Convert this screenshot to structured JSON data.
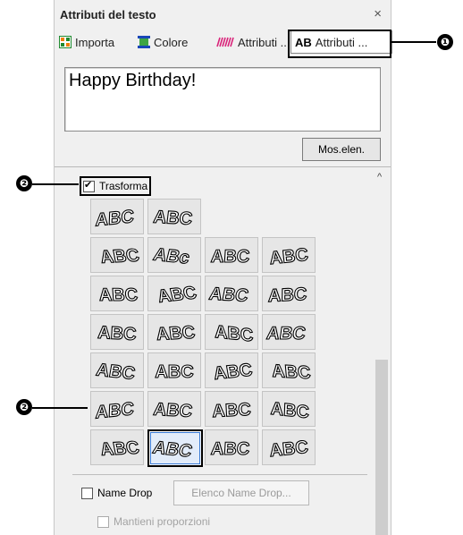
{
  "window": {
    "title": "Attributi del testo",
    "close_glyph": "×"
  },
  "tabs": [
    {
      "label": "Importa",
      "icon": "import-grid-icon"
    },
    {
      "label": "Colore",
      "icon": "color-icon"
    },
    {
      "label": "Attributi ..",
      "icon": "stitch-pattern-icon"
    },
    {
      "prefix": "AB",
      "label": "Attributi ..."
    }
  ],
  "text_input": {
    "value": "Happy Birthday!"
  },
  "mos_elen_button": "Mos.elen.",
  "trasforma": {
    "label": "Trasforma",
    "checked": true
  },
  "transform_grid": {
    "rows": 7,
    "first_row_count": 2,
    "columns": 4,
    "selected": {
      "row": 6,
      "col": 1
    },
    "samples": [
      [
        "ABC",
        "ABC"
      ],
      [
        "ABC",
        "ABc",
        "ABC",
        "ABC"
      ],
      [
        "ABC",
        "ABC",
        "ABC",
        "ABC"
      ],
      [
        "ABC",
        "ABC",
        "ABC",
        "ABC"
      ],
      [
        "ABC",
        "ABC",
        "ABC",
        "ABC"
      ],
      [
        "ABC",
        "ABC",
        "ABC",
        "ABC"
      ],
      [
        "ABC",
        "ABC",
        "ABC",
        "ABC"
      ]
    ]
  },
  "name_drop": {
    "label": "Name Drop",
    "checked": false,
    "button": "Elenco Name Drop..."
  },
  "mantieni": {
    "label": "Mantieni proporzioni",
    "checked": false
  },
  "callouts": [
    {
      "number": "❶"
    },
    {
      "number": "❷"
    },
    {
      "number": "❷"
    }
  ],
  "colors": {
    "panel": "#f0f0f0",
    "selection": "#3a7bd5"
  }
}
